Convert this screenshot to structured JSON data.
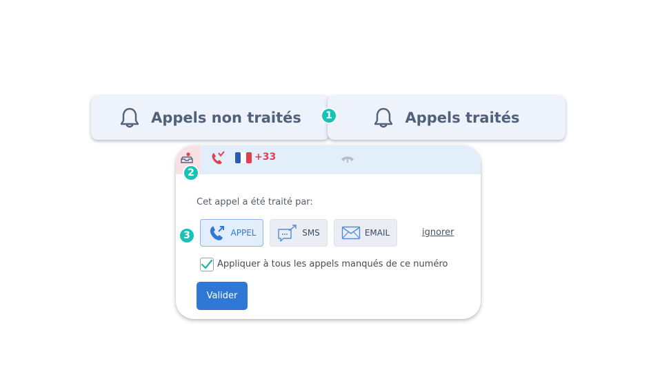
{
  "tabs": {
    "untreated": {
      "label": "Appels non traités",
      "icon": "bell-icon"
    },
    "treated": {
      "label": "Appels traités",
      "icon": "bell-icon"
    }
  },
  "badges": [
    "1",
    "2",
    "3"
  ],
  "call_row": {
    "country_code": "+33",
    "flag": "france-flag-icon",
    "call_icon": "missed-call-icon",
    "hangup_icon": "hang-up-icon",
    "status_icon": "inbox-alert-icon"
  },
  "panel": {
    "prompt": "Cet appel a été traité par:",
    "options": [
      {
        "label": "APPEL",
        "icon": "phone-call-icon",
        "selected": true
      },
      {
        "label": "SMS",
        "icon": "sms-icon",
        "selected": false
      },
      {
        "label": "EMAIL",
        "icon": "email-icon",
        "selected": false
      }
    ],
    "ignore_label": "ignorer",
    "apply_all_label": "Appliquer à tous les appels manqués de ce numéro",
    "apply_all_checked": true,
    "submit_label": "Valider"
  },
  "colors": {
    "accent": "#2f78d6",
    "badge": "#16c3b6",
    "alert": "#e0404d",
    "tab_bg": "#eef2fa"
  }
}
